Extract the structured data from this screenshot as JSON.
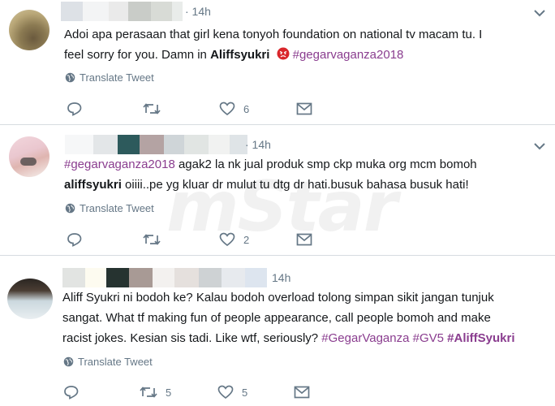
{
  "watermark": "mStar",
  "translate_label": "Translate Tweet",
  "tweets": [
    {
      "time": "· 14h",
      "text_lines": [
        "Adoi apa perasaan that girl kena tonyoh foundation on national tv macam tu. I",
        "feel sorry for you. Damn in "
      ],
      "mention": "Aliffsyukri",
      "emoji": "angry-face",
      "hashtag": "#gegarvaganza2018",
      "reply_count": "",
      "retweet_count": "",
      "like_count": "6"
    },
    {
      "time": "· 14h",
      "hashtag": "#gegarvaganza2018",
      "line1_rest": " agak2 la nk jual produk smp ckp muka org mcm bomoh",
      "mention": "aliffsyukri",
      "line2_rest": " oiiii..pe yg kluar dr mulut tu dtg dr hati.busuk bahasa busuk hati!",
      "reply_count": "",
      "retweet_count": "",
      "like_count": "2"
    },
    {
      "time": "14h",
      "text_lines": [
        "Aliff Syukri ni bodoh ke? Kalau bodoh overload tolong simpan sikit jangan tunjuk",
        "sangat. What tf making fun of people appearance, call people bomoh and make",
        "racist jokes. Kesian sis tadi. Like wtf, seriously? "
      ],
      "hashtag1": "#GegarVaganza",
      "hashtag2": "#GV5",
      "hashtag3": "#AliffSyukri",
      "reply_count": "",
      "retweet_count": "5",
      "like_count": "5"
    }
  ],
  "colors": {
    "hashtag": "#8a3d8f",
    "meta": "#657786",
    "divider": "#d7dce0"
  }
}
